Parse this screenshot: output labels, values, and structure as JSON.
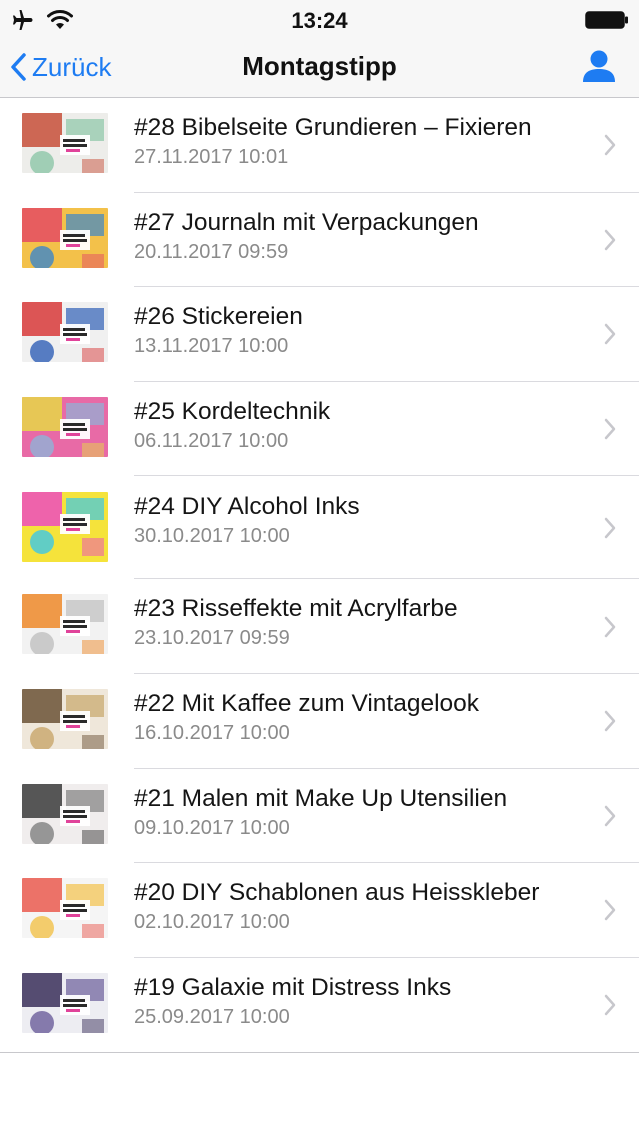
{
  "status": {
    "time": "13:24"
  },
  "nav": {
    "back_label": "Zurück",
    "title": "Montagstipp"
  },
  "items": [
    {
      "title": "#28 Bibelseite Grundieren – Fixieren",
      "date": "27.11.2017 10:01",
      "c1": "#c74f3a",
      "c2": "#8cc6a7",
      "c3": "#ededea"
    },
    {
      "title": "#27 Journaln mit Verpackungen",
      "date": "20.11.2017 09:59",
      "c1": "#e44b63",
      "c2": "#3c86c9",
      "c3": "#f3c14a"
    },
    {
      "title": "#26 Stickereien",
      "date": "13.11.2017 10:00",
      "c1": "#d83a3a",
      "c2": "#2f5fb7",
      "c3": "#f0f0f0"
    },
    {
      "title": "#25 Kordeltechnik",
      "date": "06.11.2017 10:00",
      "c1": "#e6d747",
      "c2": "#8fb3d8",
      "c3": "#e86aa6"
    },
    {
      "title": "#24 DIY Alcohol Inks",
      "date": "30.10.2017 10:00",
      "c1": "#ec4cc0",
      "c2": "#3cc7e8",
      "c3": "#f5e33b"
    },
    {
      "title": "#23 Risseffekte mit Acrylfarbe",
      "date": "23.10.2017 09:59",
      "c1": "#ee8a2a",
      "c2": "#bfbfbf",
      "c3": "#f2f2f2"
    },
    {
      "title": "#22 Mit Kaffee zum Vintagelook",
      "date": "16.10.2017 10:00",
      "c1": "#6b5236",
      "c2": "#c8a66a",
      "c3": "#efe7da"
    },
    {
      "title": "#21 Malen mit Make Up Utensilien",
      "date": "09.10.2017 10:00",
      "c1": "#3b3b3b",
      "c2": "#7f7f7f",
      "c3": "#f0eded"
    },
    {
      "title": "#20 DIY Schablonen aus Heisskleber",
      "date": "02.10.2017 10:00",
      "c1": "#ea5a4f",
      "c2": "#f3c24a",
      "c3": "#f5f5f5"
    },
    {
      "title": "#19 Galaxie mit Distress Inks",
      "date": "25.09.2017 10:00",
      "c1": "#3a2f5a",
      "c2": "#6a5c9a",
      "c3": "#ededf2"
    }
  ],
  "colors": {
    "accent": "#1e7cf2",
    "chevron": "#c7c7cc"
  }
}
